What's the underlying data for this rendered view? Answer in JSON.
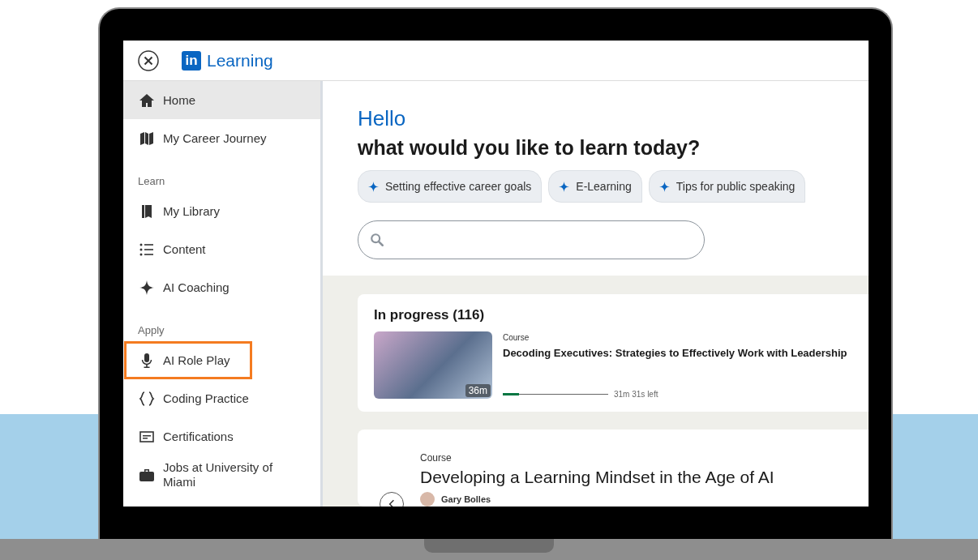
{
  "header": {
    "logo_badge": "in",
    "logo_text": "Learning"
  },
  "sidebar": {
    "items": [
      {
        "kind": "item",
        "label": "Home",
        "selected": true,
        "highlighted": false
      },
      {
        "kind": "item",
        "label": "My Career Journey",
        "selected": false,
        "highlighted": false
      },
      {
        "kind": "section",
        "label": "Learn"
      },
      {
        "kind": "item",
        "label": "My Library",
        "selected": false,
        "highlighted": false
      },
      {
        "kind": "item",
        "label": "Content",
        "selected": false,
        "highlighted": false
      },
      {
        "kind": "item",
        "label": "AI Coaching",
        "selected": false,
        "highlighted": false
      },
      {
        "kind": "section",
        "label": "Apply"
      },
      {
        "kind": "item",
        "label": "AI Role Play",
        "selected": false,
        "highlighted": true
      },
      {
        "kind": "item",
        "label": "Coding Practice",
        "selected": false,
        "highlighted": false
      },
      {
        "kind": "item",
        "label": "Certifications",
        "selected": false,
        "highlighted": false
      },
      {
        "kind": "item",
        "label": "Jobs at University of Miami",
        "selected": false,
        "highlighted": false
      }
    ]
  },
  "greeting": "Hello",
  "headline": "what would you like to learn today?",
  "suggestions": [
    "Setting effective career goals",
    "E-Learning",
    "Tips for public speaking"
  ],
  "in_progress": {
    "title": "In progress (116)",
    "course": {
      "type": "Course",
      "title": "Decoding Executives: Strategies to Effectively Work with Leadership",
      "duration": "36m",
      "level": 0.15,
      "remaining": "31m 31s left"
    }
  },
  "featured": {
    "type": "Course",
    "title": "Developing a Learning Mindset in the Age of AI",
    "author": "Gary Bolles"
  }
}
